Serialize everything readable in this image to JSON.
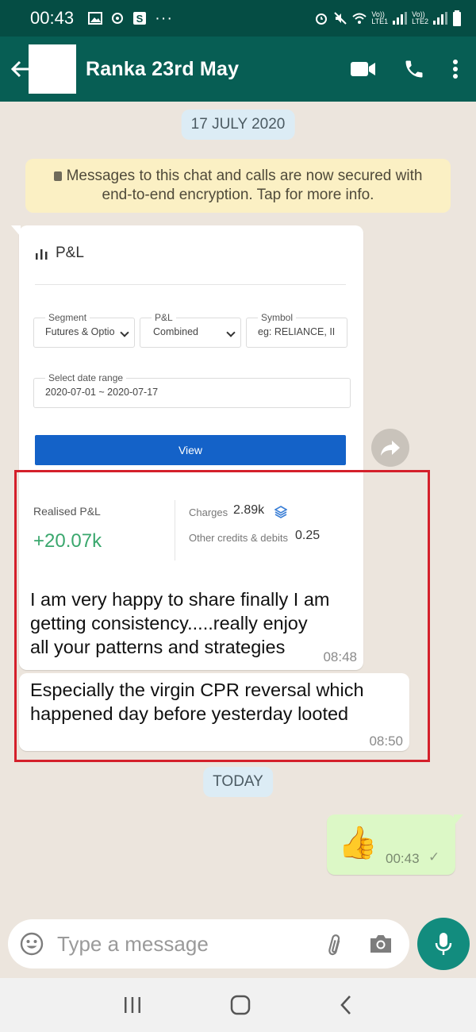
{
  "status_bar": {
    "time": "00:43",
    "sim1": "LTE1",
    "sim2": "LTE2",
    "volte": "Vo))"
  },
  "header": {
    "title": "Ranka 23rd May"
  },
  "chat": {
    "date_1": "17 JULY 2020",
    "encryption_notice": "Messages to this chat and calls are now secured with end-to-end encryption. Tap for more info.",
    "image_message": {
      "pl_title": "P&L",
      "segment_label": "Segment",
      "segment_value": "Futures & Optio",
      "pl_label": "P&L",
      "pl_value": "Combined",
      "symbol_label": "Symbol",
      "symbol_placeholder": "eg: RELIANCE, II",
      "date_range_label": "Select date range",
      "date_range_value": "2020-07-01 ~ 2020-07-17",
      "view_button": "View",
      "realised_label": "Realised P&L",
      "realised_value": "+20.07k",
      "charges_label": "Charges",
      "charges_value": "2.89k",
      "other_label": "Other credits & debits",
      "other_value": "0.25",
      "caption_line1": "I am very happy to share finally I am",
      "caption_line2": "getting consistency.....really enjoy",
      "caption_line3": "all your patterns and strategies",
      "time": "08:48"
    },
    "text_message": {
      "line1": "Especially the virgin CPR reversal which",
      "line2": "happened day before yesterday looted",
      "time": "08:50"
    },
    "date_2": "TODAY",
    "outgoing": {
      "emoji": "👍",
      "time": "00:43",
      "status": "✓"
    }
  },
  "composer": {
    "placeholder": "Type a message"
  },
  "colors": {
    "header": "#075e54",
    "status": "#054d44",
    "accent": "#128c7e",
    "outgoing": "#dcf8c6",
    "highlight": "#d4202b"
  }
}
